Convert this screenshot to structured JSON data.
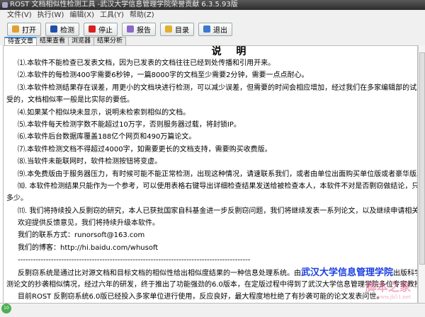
{
  "window": {
    "title": "ROST 文档相似性检测工具 -武汉大学信息管理学院荣誉贡献 6.3.5.93版"
  },
  "menu": [
    "文件(V)",
    "执行(W)",
    "编辑(X)",
    "工具(Y)",
    "帮助(Z)"
  ],
  "toolbar": [
    {
      "label": "打开",
      "icon": "open-folder-icon",
      "color": "#e0a030"
    },
    {
      "label": "检测",
      "icon": "save-disk-icon",
      "color": "#1f4fa8"
    },
    {
      "label": "停止",
      "icon": "stop-icon",
      "color": "#d92020"
    },
    {
      "label": "报告",
      "icon": "report-icon",
      "color": "#8a6ac8"
    },
    {
      "label": "目录",
      "icon": "directory-icon",
      "color": "#e0b030"
    },
    {
      "label": "退出",
      "icon": "exit-icon",
      "color": "#3a7ad0"
    }
  ],
  "tabs": [
    "待查文章",
    "结果查看",
    "浏览器",
    "结果分析"
  ],
  "doc": {
    "title": "说 明",
    "lines": [
      {
        "t": "⑴.本软件不能检查已发表文档，因为已发表的文档往往已经到处传播和引用开来。",
        "i": true
      },
      {
        "t": "⑵.本软件的每检测400字需要6秒钟，一篇8000字的文档至少需要2分钟，需要一点点耐心。",
        "i": true
      },
      {
        "t": "⑶.本软件检测结果存在误差，用更小的文档块进行检测，可以减少误差，但需要的时间会相应增加，经过我们在多家编辑部的试用情况，",
        "i": true
      },
      {
        "t": "受的，文档相似率一般是比实际的要低。",
        "i": false
      },
      {
        "t": "⑷.如果某个相似块未显示，说明未检索到相似的文档。",
        "i": true
      },
      {
        "t": "⑸.本软件每天检测字数不能超过10万字，否则服务器过载，将封锁IP。",
        "i": true
      },
      {
        "t": "⑹.本软件后台数据库覆盖188亿个网页和490万篇论文。",
        "i": true
      },
      {
        "t": "⑺.本软件检测文档不得超过4000字，如需要更长的文档支持，需要购买收费版。",
        "i": true
      },
      {
        "t": "⑻.当软件未能联网时，软件检测按钮将变虚。",
        "i": true
      },
      {
        "t": "⑼.本免费版由于服务器压力，有时候可能不能正常检测，出现这种情况，请速联系我们，或者由单位出面购买单位版或者豪华版。",
        "i": true
      },
      {
        "t": "⑽. 本软件检测结果只能作为一个参考，可以使用表格右键导出详细检查结果发送给被检查本人，本软件不对是否剽窃做结论，只是告诉你",
        "i": true
      },
      {
        "t": "多少。",
        "i": false
      },
      {
        "t": "⑾. 我们将持续投入反剽窃的研究，本人已获批国家自科基金进一步反剽窃问题，我们将继续发表一系列论文，以及继续申请相关专利。软",
        "i": true
      },
      {
        "t": "欢迎提供反馈意见，我们将持续升级本软件。",
        "i": true
      },
      {
        "t": "我们的联系方式：runorsoft@163.com",
        "i": true
      },
      {
        "t": "我们的博客：http://hi.baidu.com/whusoft",
        "i": true
      },
      {
        "t": "-------------------------------------------------------------------------------------------",
        "i": true
      }
    ],
    "intro_before": "反剽窃系统是通过比对源文档和目标文档的相似性给出相似度结果的一种信息处理系统。由",
    "intro_highlight": "武汉大学信息管理学院",
    "intro_after": "出版科学系教师",
    "line2": "测论文的抄袭相似情况，经过六年的研发，终于推出了功能强劲的6.0版本，在定版过程中得到了武汉大学信息管理学院多位专家教授的宝贵意见",
    "line3": "目前ROST 反剽窃系统6.0版已经投入多家单位进行使用，反应良好，最大程度地杜绝了有抄袭可能的论文发表问世。"
  },
  "watermark": {
    "text": "脚本之家",
    "url": "www.jb51.net"
  },
  "status": {
    "badge": "10"
  },
  "colors": {
    "highlight": "#1a3ee0",
    "tab_active": "#3a8ee6"
  }
}
